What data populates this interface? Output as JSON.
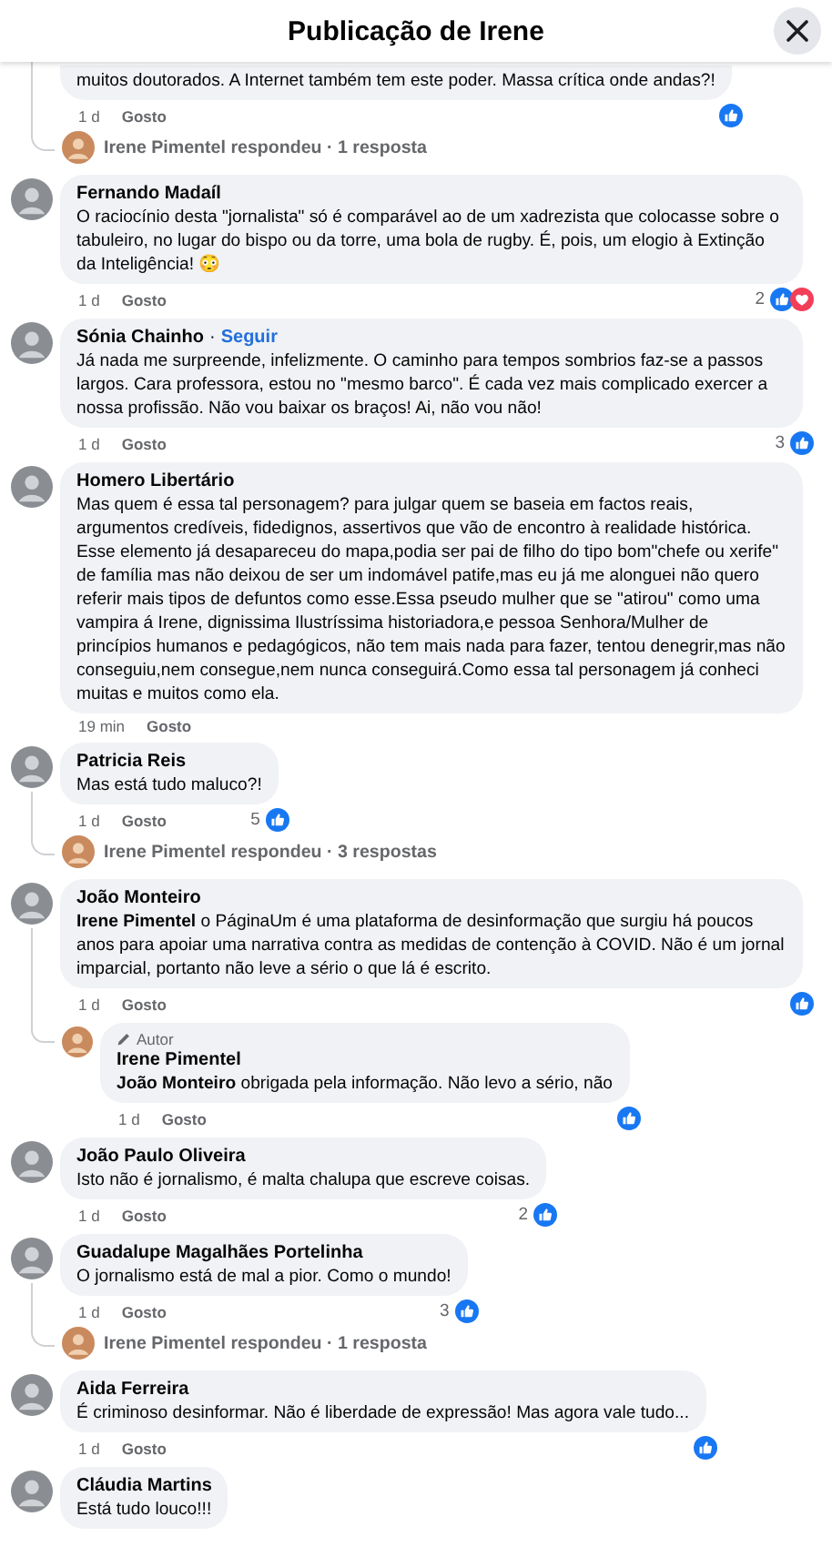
{
  "header": {
    "title": "Publicação de Irene"
  },
  "comments": [
    {
      "text": "muitos doutorados. A Internet também tem este poder. Massa crítica onde andas?!",
      "time": "1 d",
      "like": "Gosto",
      "reactions": [
        {
          "kind": "like"
        }
      ],
      "summary": {
        "text": "Irene Pimentel respondeu · 1 resposta"
      }
    },
    {
      "author": "Fernando Madaíl",
      "text": "O raciocínio desta \"jornalista\" só é comparável ao de um xadrezista que colocasse sobre o tabuleiro, no lugar do bispo ou da torre, uma bola de rugby. É, pois, um elogio à Extinção da Inteligência! 😳",
      "time": "1 d",
      "like": "Gosto",
      "count": "2",
      "reactions": [
        {
          "kind": "like"
        },
        {
          "kind": "love"
        }
      ]
    },
    {
      "author": "Sónia Chainho",
      "separator": "·",
      "follow": "Seguir",
      "text": "Já nada me surpreende, infelizmente. O caminho para tempos sombrios faz-se a passos largos. Cara professora, estou no \"mesmo barco\". É cada vez mais complicado exercer a nossa profissão. Não vou baixar os braços! Ai, não vou não!",
      "time": "1 d",
      "like": "Gosto",
      "count": "3",
      "reactions": [
        {
          "kind": "like"
        }
      ]
    },
    {
      "author": "Homero Libertário",
      "text": "Mas quem é essa tal personagem? para julgar quem se baseia em factos reais, argumentos credíveis, fidedignos, assertivos que vão de encontro à realidade histórica. Esse elemento já desapareceu do mapa,podia ser pai de filho do tipo bom\"chefe ou xerife\" de família mas não deixou de ser um indomável patife,mas eu já me alonguei não quero referir mais tipos de defuntos como esse.Essa pseudo mulher que se \"atirou\" como uma vampira á Irene, dignissima Ilustríssima historiadora,e pessoa Senhora/Mulher de princípios humanos e pedagógicos, não tem mais nada para fazer, tentou denegrir,mas não conseguiu,nem consegue,nem nunca conseguirá.Como essa tal personagem já conheci muitas e muitos como ela.",
      "time": "19 min",
      "like": "Gosto"
    },
    {
      "author": "Patricia Reis",
      "text": "Mas está tudo maluco?!",
      "time": "1 d",
      "like": "Gosto",
      "count": "5",
      "reactions": [
        {
          "kind": "like"
        }
      ],
      "summary": {
        "text": "Irene Pimentel respondeu · 3 respostas"
      }
    },
    {
      "author": "João Monteiro",
      "text": "**Irene Pimentel** o PáginaUm é uma plataforma de desinformação que surgiu há poucos anos para apoiar uma narrativa contra as medidas de contenção à COVID. Não é um jornal imparcial, portanto não leve a sério o que lá é escrito.",
      "time": "1 d",
      "like": "Gosto",
      "reactions": [
        {
          "kind": "like"
        }
      ],
      "replies": [
        {
          "badge": "Autor",
          "author": "Irene Pimentel",
          "text": "**João Monteiro** obrigada pela informação. Não levo a sério, não",
          "time": "1 d",
          "like": "Gosto",
          "reactions": [
            {
              "kind": "like"
            }
          ]
        }
      ]
    },
    {
      "author": "João Paulo Oliveira",
      "text": "Isto não é jornalismo, é malta chalupa que escreve coisas.",
      "time": "1 d",
      "like": "Gosto",
      "count": "2",
      "reactions": [
        {
          "kind": "like"
        }
      ]
    },
    {
      "author": "Guadalupe Magalhães Portelinha",
      "text": "O jornalismo está de mal a pior. Como o mundo!",
      "time": "1 d",
      "like": "Gosto",
      "count": "3",
      "reactions": [
        {
          "kind": "like"
        }
      ],
      "summary": {
        "text": "Irene Pimentel respondeu · 1 resposta"
      }
    },
    {
      "author": "Aida Ferreira",
      "text": "É criminoso desinformar. Não é liberdade de expressão! Mas agora vale tudo...",
      "time": "1 d",
      "like": "Gosto",
      "reactions": [
        {
          "kind": "like"
        }
      ]
    },
    {
      "author": "Cláudia Martins",
      "text": "Está tudo louco!!!"
    }
  ]
}
